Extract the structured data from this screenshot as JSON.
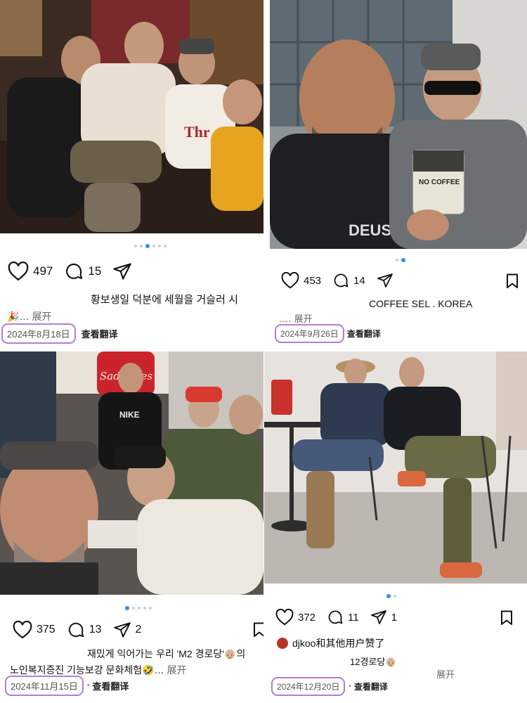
{
  "posts": [
    {
      "likes": "497",
      "comments": "15",
      "caption": "황보생일 덕분에 세월을 거슬러 시",
      "more_prefix": "🎉…",
      "expand": "展开",
      "date": "2024年8月18日",
      "translate": "查看翻译"
    },
    {
      "likes": "453",
      "comments": "14",
      "caption": "COFFEE SEL . KOREA",
      "more_prefix": ".…",
      "expand": "展开",
      "date": "2024年9月26日",
      "translate": "查看翻译",
      "cup_text": "NO COFFEE",
      "shirt_text": "DEUS"
    },
    {
      "likes": "375",
      "comments": "13",
      "shares": "2",
      "caption": "재밌게 익어가는 우리 'M2 경로당'👴🏼의",
      "more_prefix": "노인복지증진 기능보강 문화체험🤣…",
      "expand": "展开",
      "date": "2024年11月15日",
      "translate": "查看翻译",
      "sign_text": "Sad Vibes",
      "jersey_text": "NIKE"
    },
    {
      "likes": "372",
      "comments": "11",
      "shares": "1",
      "liked_by": "djkoo和其他用户赞了",
      "caption": "12경로당👴🏼",
      "expand": "展开",
      "date": "2024年12月20日",
      "translate": "查看翻译"
    }
  ],
  "colors": {
    "accent_dot": "#3a8bf0",
    "date_highlight": "#b07fd6"
  },
  "icons": [
    "heart-icon",
    "comment-icon",
    "share-icon",
    "bookmark-icon"
  ]
}
